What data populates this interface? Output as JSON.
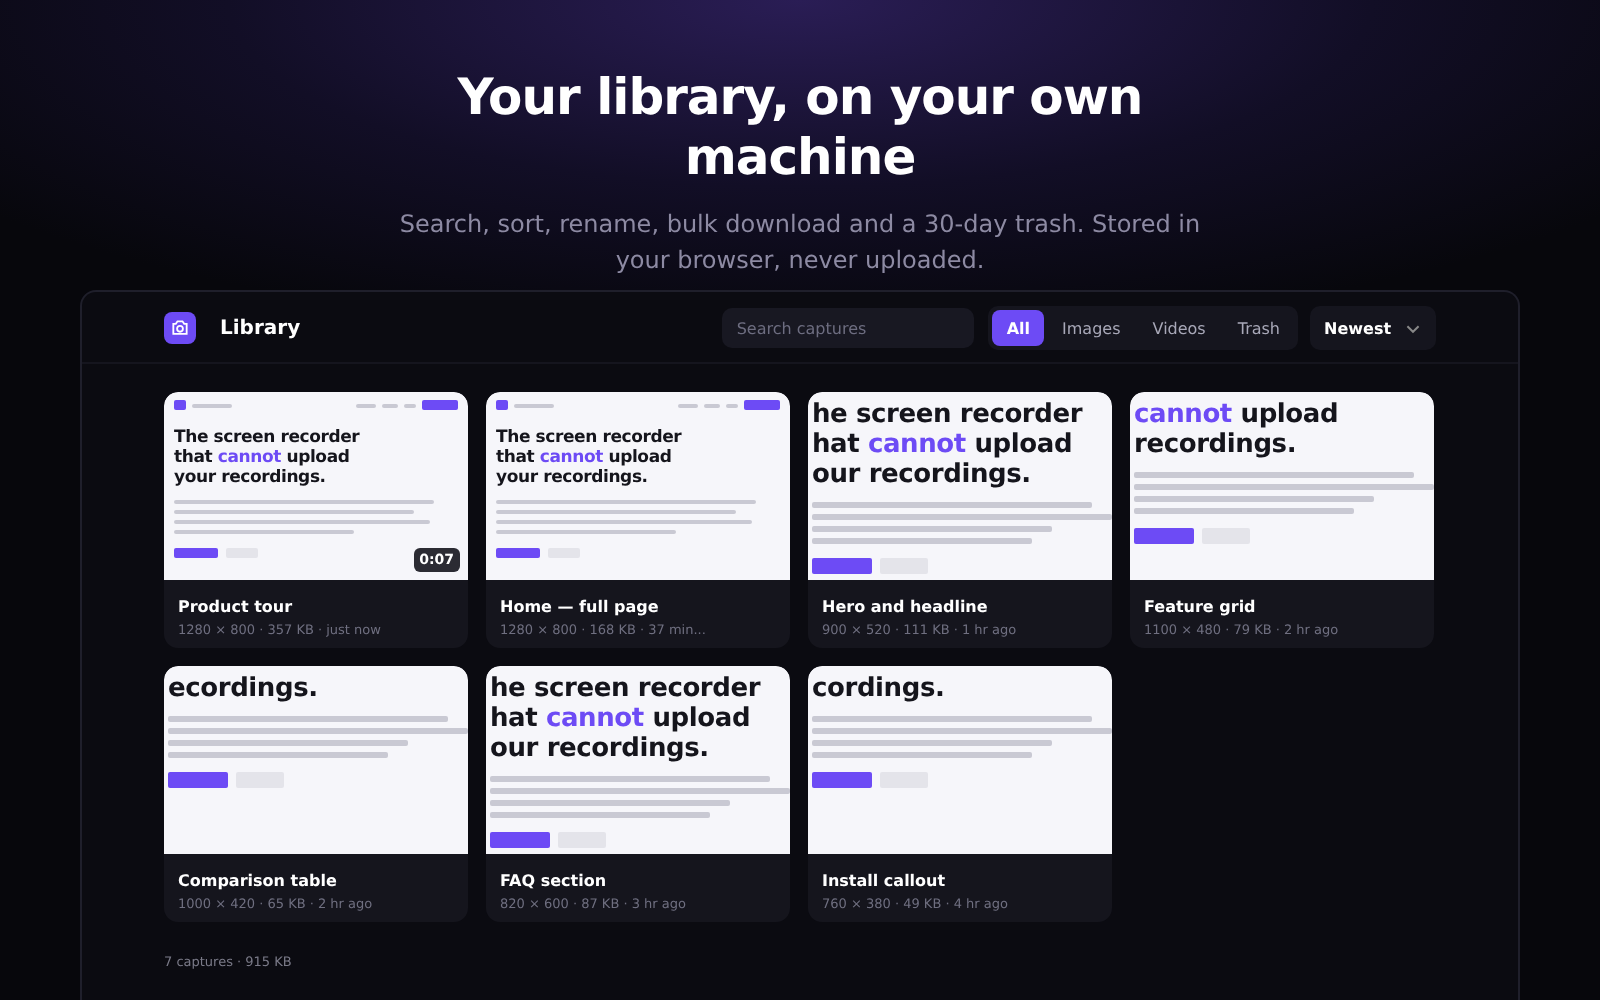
{
  "hero": {
    "title": "Your library, on your own machine",
    "subtitle": "Search, sort, rename, bulk download and a 30-day trash. Stored in your browser, never uploaded."
  },
  "panel": {
    "title": "Library",
    "search": {
      "placeholder": "Search captures"
    },
    "filters": [
      {
        "label": "All",
        "selected": true
      },
      {
        "label": "Images",
        "selected": false
      },
      {
        "label": "Videos",
        "selected": false
      },
      {
        "label": "Trash",
        "selected": false
      }
    ],
    "sort": {
      "value": "Newest"
    },
    "captures": [
      {
        "name": "Product tour",
        "meta": "1280 × 800 · 357 KB · just now",
        "thumb": {
          "kind": "page",
          "duration": "0:07",
          "lines": [
            [
              {
                "t": "The screen recorder"
              }
            ],
            [
              {
                "t": "that "
              },
              {
                "t": "cannot",
                "accent": true
              },
              {
                "t": " upload"
              }
            ],
            [
              {
                "t": "your recordings."
              }
            ]
          ]
        }
      },
      {
        "name": "Home — full page",
        "meta": "1280 × 800 · 168 KB · 37 min...",
        "thumb": {
          "kind": "page",
          "lines": [
            [
              {
                "t": "The screen recorder"
              }
            ],
            [
              {
                "t": "that "
              },
              {
                "t": "cannot",
                "accent": true
              },
              {
                "t": " upload"
              }
            ],
            [
              {
                "t": "your recordings."
              }
            ]
          ]
        }
      },
      {
        "name": "Hero and headline",
        "meta": "900 × 520 · 111 KB · 1 hr ago",
        "thumb": {
          "kind": "crop",
          "lines": [
            [
              {
                "t": "he screen recorder"
              }
            ],
            [
              {
                "t": "hat "
              },
              {
                "t": "cannot",
                "accent": true
              },
              {
                "t": " upload"
              }
            ],
            [
              {
                "t": "our recordings."
              }
            ]
          ]
        }
      },
      {
        "name": "Feature grid",
        "meta": "1100 × 480 · 79 KB · 2 hr ago",
        "thumb": {
          "kind": "crop",
          "lines": [
            [
              {
                "t": "cannot",
                "accent": true
              },
              {
                "t": " upload"
              }
            ],
            [
              {
                "t": "recordings."
              }
            ]
          ]
        }
      },
      {
        "name": "Comparison table",
        "meta": "1000 × 420 · 65 KB · 2 hr ago",
        "thumb": {
          "kind": "crop",
          "lines": [
            [
              {
                "t": "ecordings."
              }
            ]
          ]
        }
      },
      {
        "name": "FAQ section",
        "meta": "820 × 600 · 87 KB · 3 hr ago",
        "thumb": {
          "kind": "crop",
          "lines": [
            [
              {
                "t": "he screen recorder"
              }
            ],
            [
              {
                "t": "hat "
              },
              {
                "t": "cannot",
                "accent": true
              },
              {
                "t": " upload"
              }
            ],
            [
              {
                "t": "our recordings."
              }
            ]
          ]
        }
      },
      {
        "name": "Install callout",
        "meta": "760 × 380 · 49 KB · 4 hr ago",
        "thumb": {
          "kind": "crop",
          "lines": [
            [
              {
                "t": "cordings."
              }
            ]
          ]
        }
      }
    ],
    "footer": "7 captures · 915 KB"
  }
}
